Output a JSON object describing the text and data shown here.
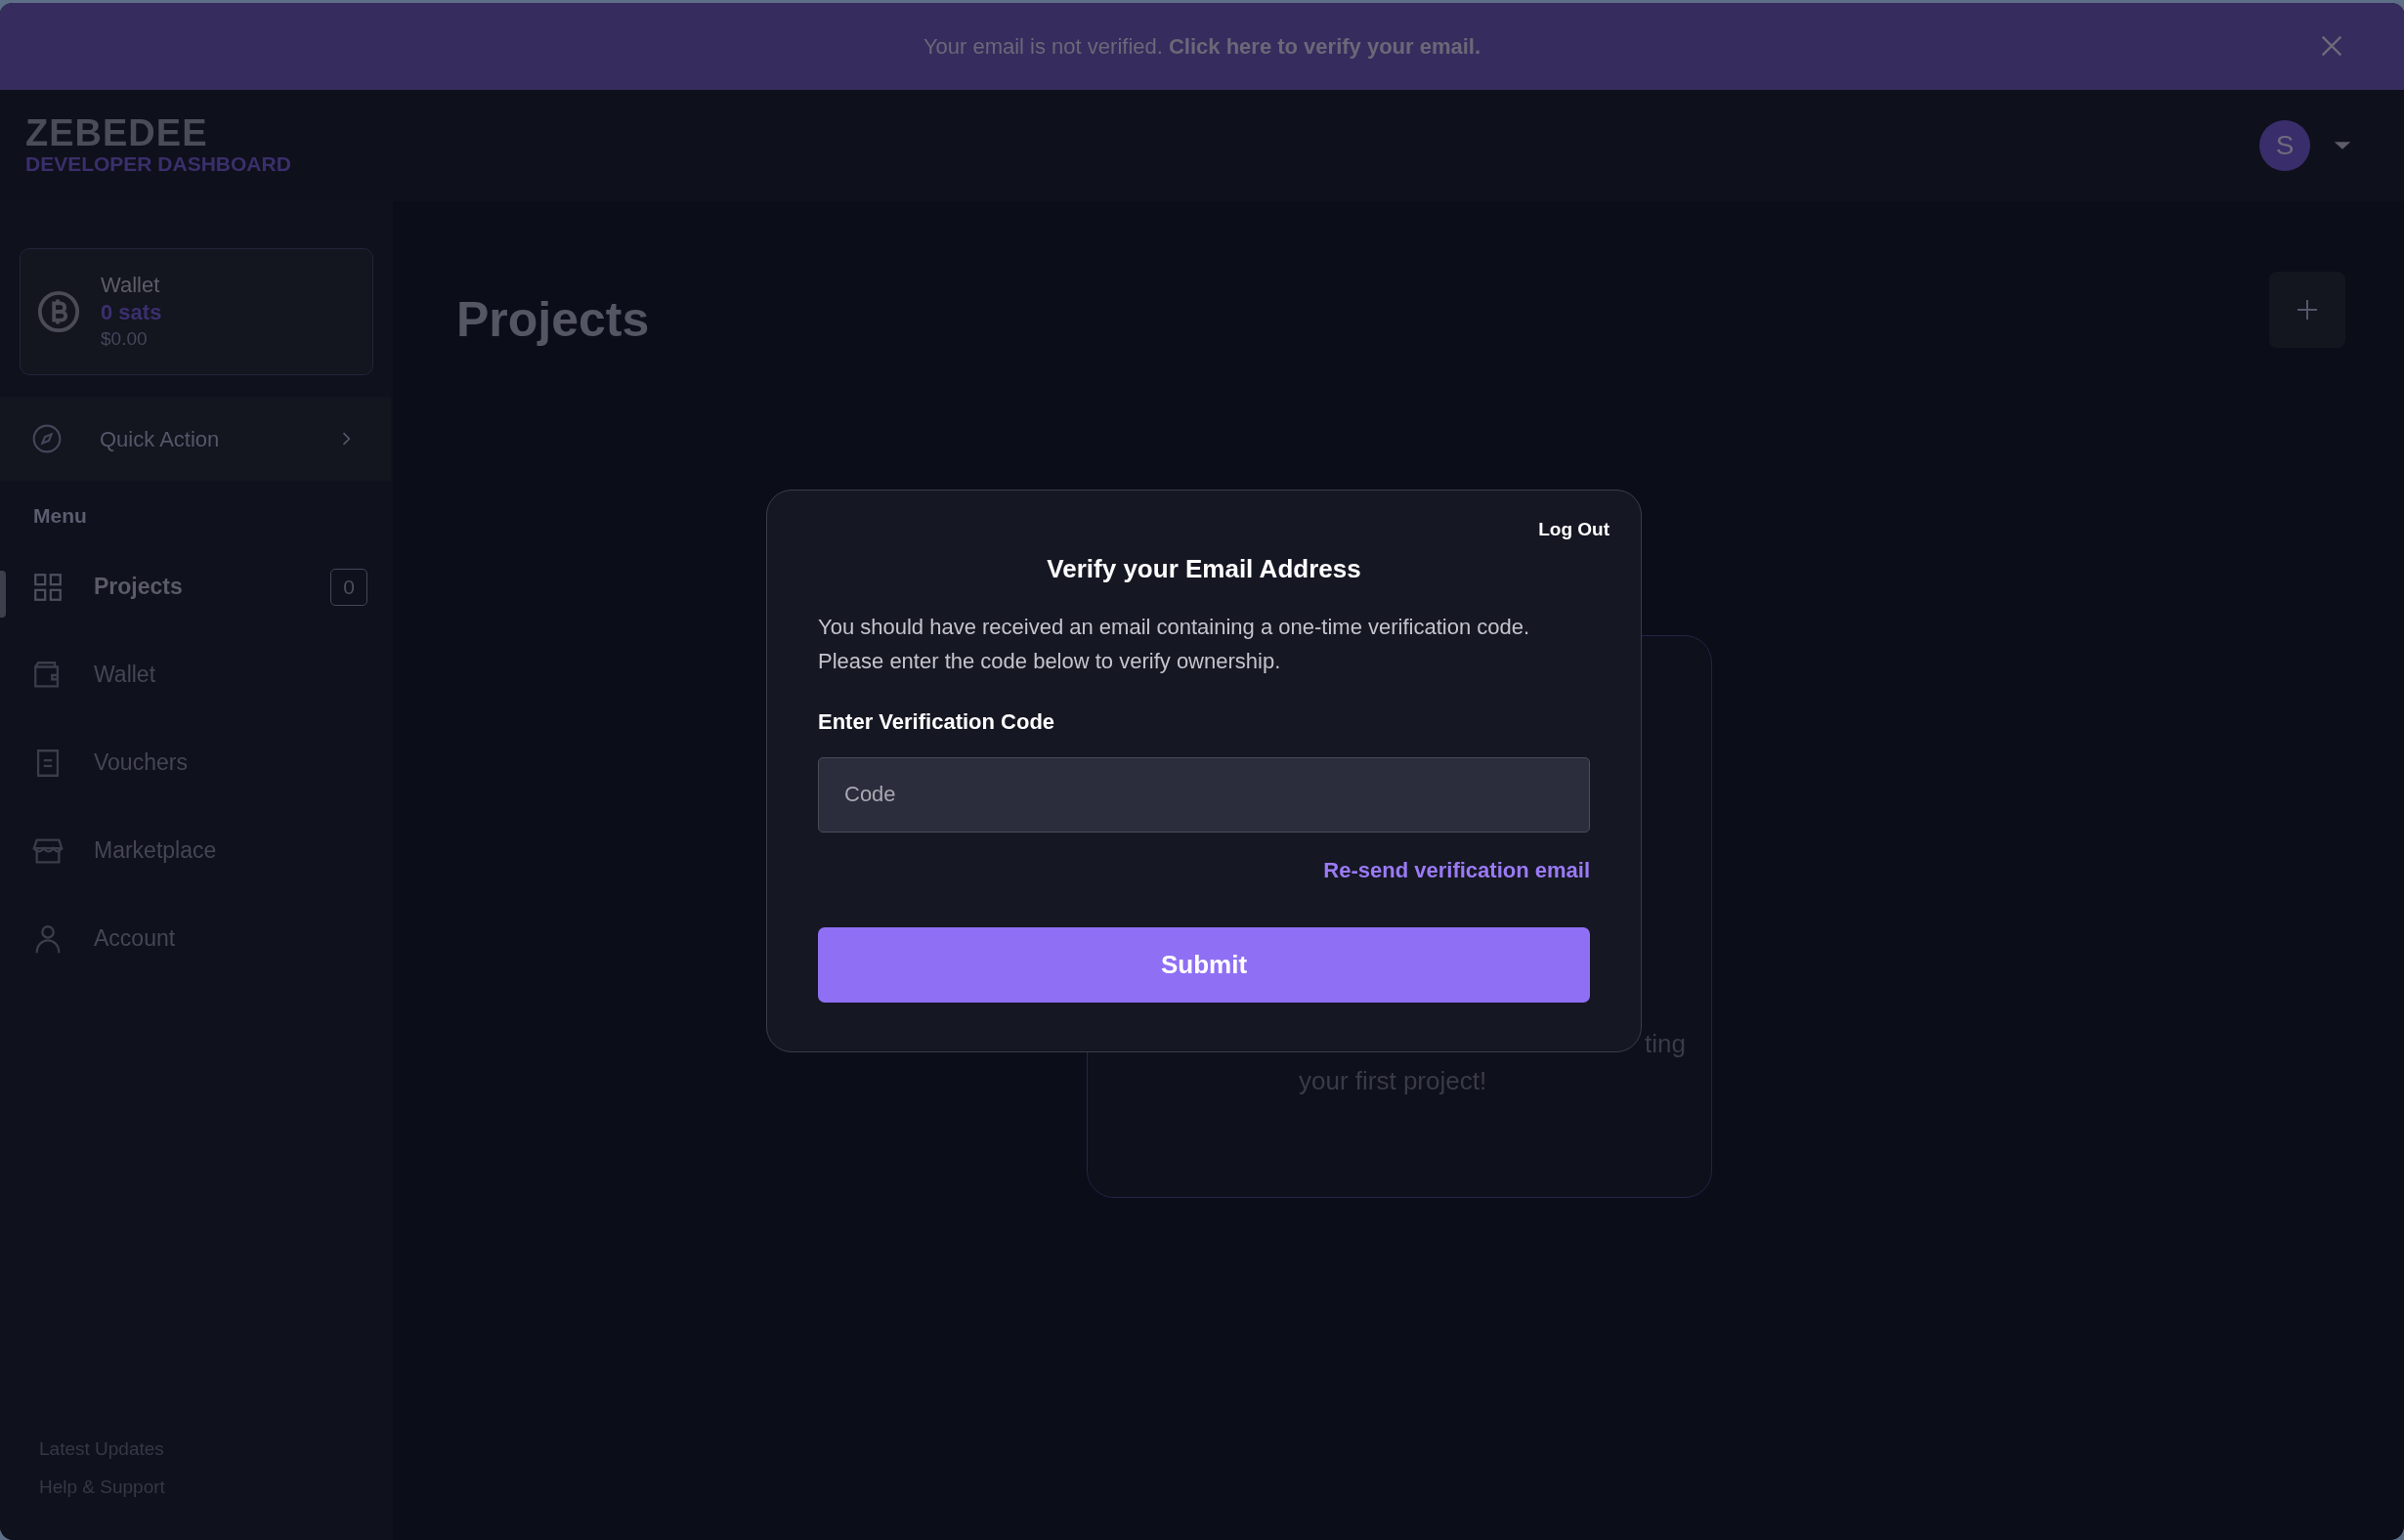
{
  "banner": {
    "text": "Your email is not verified.",
    "link": "Click here to verify your email."
  },
  "brand": {
    "name": "ZEBEDEE",
    "subtitle": "DEVELOPER DASHBOARD"
  },
  "user": {
    "initial": "S"
  },
  "wallet_card": {
    "label": "Wallet",
    "balance": "0 sats",
    "fiat": "$0.00"
  },
  "quick_action": {
    "label": "Quick Action"
  },
  "menu": {
    "heading": "Menu",
    "items": [
      {
        "label": "Projects",
        "selected": true,
        "count": "0"
      },
      {
        "label": "Wallet",
        "selected": false
      },
      {
        "label": "Vouchers",
        "selected": false
      },
      {
        "label": "Marketplace",
        "selected": false
      },
      {
        "label": "Account",
        "selected": false
      }
    ]
  },
  "footer_links": [
    "Latest Updates",
    "Help & Support"
  ],
  "page": {
    "title": "Projects",
    "empty_card": {
      "line_1": "ting",
      "line_2": "your first project!"
    }
  },
  "modal": {
    "logout": "Log Out",
    "title": "Verify your Email Address",
    "message": "You should have received an email containing a one-time verification code. Please enter the code below to verify ownership.",
    "field_label": "Enter Verification Code",
    "placeholder": "Code",
    "resend": "Re-send verification email",
    "submit": "Submit"
  }
}
